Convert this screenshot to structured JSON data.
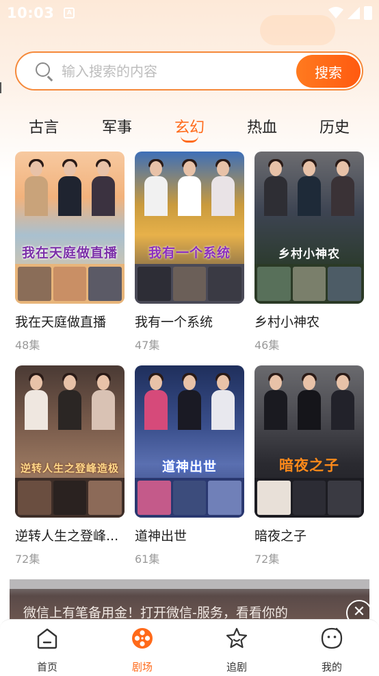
{
  "status_bar": {
    "time": "10:03",
    "app_icon_letter": "A"
  },
  "search": {
    "placeholder": "输入搜索的内容",
    "button_label": "搜索"
  },
  "categories": {
    "tabs": [
      "古言",
      "军事",
      "玄幻",
      "热血",
      "历史"
    ],
    "active": "玄幻"
  },
  "dramas": [
    {
      "title": "我在天庭做直播",
      "episodes": "48集",
      "poster_text": "我在天庭做直播"
    },
    {
      "title": "我有一个系统",
      "episodes": "47集",
      "poster_text": "我有一个系统"
    },
    {
      "title": "乡村小神农",
      "episodes": "46集",
      "poster_text": "乡村小神农"
    },
    {
      "title": "逆转人生之登峰...",
      "episodes": "72集",
      "poster_text": "逆转人生之登峰造极"
    },
    {
      "title": "道神出世",
      "episodes": "61集",
      "poster_text": "道神出世"
    },
    {
      "title": "暗夜之子",
      "episodes": "72集",
      "poster_text": "暗夜之子"
    }
  ],
  "ad_banner": {
    "text": "微信上有笔备用金！打开微信-服务，看看你的",
    "close_icon": "close-icon"
  },
  "bottom_nav": [
    {
      "label": "首页",
      "icon": "home-icon"
    },
    {
      "label": "剧场",
      "icon": "film-reel-icon"
    },
    {
      "label": "追剧",
      "icon": "star-icon"
    },
    {
      "label": "我的",
      "icon": "profile-face-icon"
    }
  ],
  "colors": {
    "accent": "#ff6a1a",
    "search_border": "#f5893a"
  }
}
